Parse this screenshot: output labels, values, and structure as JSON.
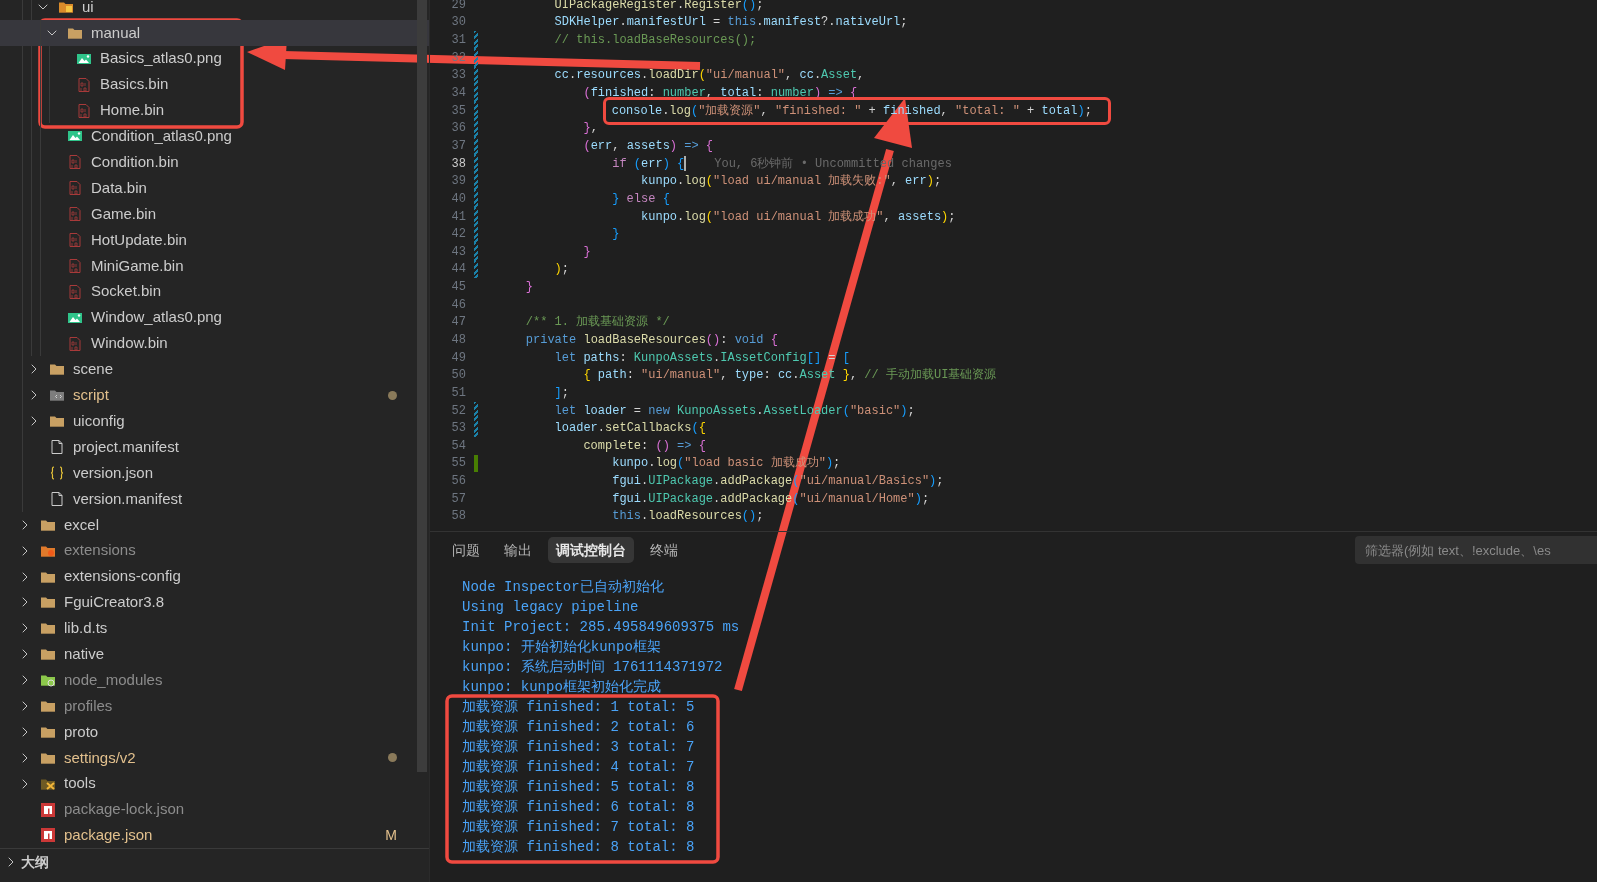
{
  "explorer": {
    "tree": [
      {
        "children": [
          {
            "children": [
              {
                "label": "ui",
                "kind": "folder-ui",
                "expanded": true,
                "selected": false,
                "children": [
                  {
                    "label": "manual",
                    "kind": "folder",
                    "expanded": true,
                    "selected": true,
                    "children": [
                      {
                        "label": "Basics_atlas0.png",
                        "kind": "image",
                        "selected": false
                      },
                      {
                        "label": "Basics.bin",
                        "kind": "binary",
                        "selected": false
                      },
                      {
                        "label": "Home.bin",
                        "kind": "binary",
                        "selected": false
                      }
                    ]
                  },
                  {
                    "label": "Condition_atlas0.png",
                    "kind": "image",
                    "selected": false
                  },
                  {
                    "label": "Condition.bin",
                    "kind": "binary",
                    "selected": false
                  },
                  {
                    "label": "Data.bin",
                    "kind": "binary",
                    "selected": false
                  },
                  {
                    "label": "Game.bin",
                    "kind": "binary",
                    "selected": false
                  },
                  {
                    "label": "HotUpdate.bin",
                    "kind": "binary",
                    "selected": false
                  },
                  {
                    "label": "MiniGame.bin",
                    "kind": "binary",
                    "selected": false
                  },
                  {
                    "label": "Socket.bin",
                    "kind": "binary",
                    "selected": false
                  },
                  {
                    "label": "Window_atlas0.png",
                    "kind": "image",
                    "selected": false
                  },
                  {
                    "label": "Window.bin",
                    "kind": "binary",
                    "selected": false
                  }
                ]
              }
            ]
          },
          {
            "label": "scene",
            "kind": "folder",
            "expanded": false,
            "selected": false
          },
          {
            "label": "script",
            "kind": "folder-script",
            "expanded": false,
            "selected": false,
            "modified": true
          },
          {
            "label": "uiconfig",
            "kind": "folder",
            "expanded": false,
            "selected": false
          },
          {
            "label": "project.manifest",
            "kind": "document",
            "selected": false
          },
          {
            "label": "version.json",
            "kind": "json",
            "selected": false
          },
          {
            "label": "version.manifest",
            "kind": "document",
            "selected": false
          }
        ]
      },
      {
        "label": "excel",
        "kind": "folder",
        "expanded": false,
        "selected": false
      },
      {
        "label": "extensions",
        "kind": "folder-plugin",
        "expanded": false,
        "selected": false,
        "ignored": true
      },
      {
        "label": "extensions-config",
        "kind": "folder",
        "expanded": false,
        "selected": false
      },
      {
        "label": "FguiCreator3.8",
        "kind": "folder",
        "expanded": false,
        "selected": false
      },
      {
        "label": "lib.d.ts",
        "kind": "folder",
        "expanded": false,
        "selected": false
      },
      {
        "label": "native",
        "kind": "folder",
        "expanded": false,
        "selected": false
      },
      {
        "label": "node_modules",
        "kind": "folder-node",
        "expanded": false,
        "selected": false,
        "ignored": true
      },
      {
        "label": "profiles",
        "kind": "folder",
        "expanded": false,
        "selected": false,
        "ignored": true
      },
      {
        "label": "proto",
        "kind": "folder",
        "expanded": false,
        "selected": false
      },
      {
        "label": "settings/v2",
        "kind": "folder",
        "expanded": false,
        "selected": false,
        "modified": true
      },
      {
        "label": "tools",
        "kind": "folder-tools",
        "expanded": false,
        "selected": false
      },
      {
        "label": "package-lock.json",
        "kind": "npm",
        "selected": false,
        "ignored": true
      },
      {
        "label": "package.json",
        "kind": "npm",
        "selected": false,
        "modified": true,
        "badge": "M"
      }
    ],
    "outline": {
      "label": "大纲",
      "expanded": false
    }
  },
  "editor": {
    "lines": [
      {
        "number": "29",
        "active": false,
        "tokens": [
          {
            "kind": "fn",
            "text": "        UIPackageRegister"
          },
          {
            "kind": "punct",
            "text": "."
          },
          {
            "kind": "fn",
            "text": "Register"
          },
          {
            "kind": "b3",
            "text": "()"
          },
          {
            "kind": "punct",
            "text": ";"
          }
        ]
      },
      {
        "number": "30",
        "active": false,
        "tokens": [
          {
            "kind": "var",
            "text": "        SDKHelper"
          },
          {
            "kind": "punct",
            "text": "."
          },
          {
            "kind": "var",
            "text": "manifestUrl"
          },
          {
            "kind": "punct",
            "text": " = "
          },
          {
            "kind": "kw",
            "text": "this"
          },
          {
            "kind": "punct",
            "text": "."
          },
          {
            "kind": "var",
            "text": "manifest"
          },
          {
            "kind": "punct",
            "text": "?."
          },
          {
            "kind": "var",
            "text": "nativeUrl"
          },
          {
            "kind": "punct",
            "text": ";"
          }
        ]
      },
      {
        "number": "31",
        "modified": true,
        "active": false,
        "tokens": [
          {
            "kind": "comment",
            "text": "        // this.loadBaseResources();"
          }
        ]
      },
      {
        "number": "32",
        "modified": true,
        "active": false
      },
      {
        "number": "33",
        "modified": true,
        "active": false,
        "tokens": [
          {
            "kind": "var",
            "text": "        cc"
          },
          {
            "kind": "punct",
            "text": "."
          },
          {
            "kind": "var",
            "text": "resources"
          },
          {
            "kind": "punct",
            "text": "."
          },
          {
            "kind": "fn",
            "text": "loadDir"
          },
          {
            "kind": "b1",
            "text": "("
          },
          {
            "kind": "str",
            "text": "\"ui/manual\""
          },
          {
            "kind": "punct",
            "text": ", "
          },
          {
            "kind": "var",
            "text": "cc"
          },
          {
            "kind": "punct",
            "text": "."
          },
          {
            "kind": "type",
            "text": "Asset"
          },
          {
            "kind": "punct",
            "text": ","
          }
        ]
      },
      {
        "number": "34",
        "modified": true,
        "active": false,
        "tokens": [
          {
            "kind": "b2",
            "text": "            ("
          },
          {
            "kind": "var",
            "text": "finished"
          },
          {
            "kind": "punct",
            "text": ": "
          },
          {
            "kind": "type",
            "text": "number"
          },
          {
            "kind": "punct",
            "text": ", "
          },
          {
            "kind": "var",
            "text": "total"
          },
          {
            "kind": "punct",
            "text": ": "
          },
          {
            "kind": "type",
            "text": "number"
          },
          {
            "kind": "b2",
            "text": ")"
          },
          {
            "kind": "kw",
            "text": " =>"
          },
          {
            "kind": "b2",
            "text": " {"
          }
        ]
      },
      {
        "number": "35",
        "modified": true,
        "highlighted": true,
        "active": false,
        "tokens": [
          {
            "kind": "var",
            "text": "                console"
          },
          {
            "kind": "punct",
            "text": "."
          },
          {
            "kind": "fn",
            "text": "log"
          },
          {
            "kind": "b3",
            "text": "("
          },
          {
            "kind": "str",
            "text": "\"加载资源\""
          },
          {
            "kind": "punct",
            "text": ", "
          },
          {
            "kind": "str",
            "text": "\"finished: \""
          },
          {
            "kind": "punct",
            "text": " + "
          },
          {
            "kind": "var",
            "text": "finished"
          },
          {
            "kind": "punct",
            "text": ", "
          },
          {
            "kind": "str",
            "text": "\"total: \""
          },
          {
            "kind": "punct",
            "text": " + "
          },
          {
            "kind": "var",
            "text": "total"
          },
          {
            "kind": "b3",
            "text": ")"
          },
          {
            "kind": "punct",
            "text": ";"
          }
        ]
      },
      {
        "number": "36",
        "modified": true,
        "active": false,
        "tokens": [
          {
            "kind": "b2",
            "text": "            }"
          },
          {
            "kind": "punct",
            "text": ","
          }
        ]
      },
      {
        "number": "37",
        "modified": true,
        "active": false,
        "tokens": [
          {
            "kind": "b2",
            "text": "            ("
          },
          {
            "kind": "var",
            "text": "err"
          },
          {
            "kind": "punct",
            "text": ", "
          },
          {
            "kind": "var",
            "text": "assets"
          },
          {
            "kind": "b2",
            "text": ")"
          },
          {
            "kind": "kw",
            "text": " =>"
          },
          {
            "kind": "b2",
            "text": " {"
          }
        ]
      },
      {
        "number": "38",
        "modified": true,
        "active": true,
        "blame": "You, 6秒钟前 • Uncommitted changes",
        "tokens": [
          {
            "kind": "ctrl",
            "text": "                if"
          },
          {
            "kind": "b3",
            "text": " ("
          },
          {
            "kind": "var",
            "text": "err"
          },
          {
            "kind": "b3",
            "text": ")"
          },
          {
            "kind": "b3",
            "text": " {"
          }
        ]
      },
      {
        "number": "39",
        "modified": true,
        "active": false,
        "tokens": [
          {
            "kind": "var",
            "text": "                    kunpo"
          },
          {
            "kind": "punct",
            "text": "."
          },
          {
            "kind": "fn",
            "text": "log"
          },
          {
            "kind": "b1",
            "text": "("
          },
          {
            "kind": "str",
            "text": "\"load ui/manual 加载失败:\""
          },
          {
            "kind": "punct",
            "text": ", "
          },
          {
            "kind": "var",
            "text": "err"
          },
          {
            "kind": "b1",
            "text": ")"
          },
          {
            "kind": "punct",
            "text": ";"
          }
        ]
      },
      {
        "number": "40",
        "modified": true,
        "active": false,
        "tokens": [
          {
            "kind": "b3",
            "text": "                }"
          },
          {
            "kind": "ctrl",
            "text": " else"
          },
          {
            "kind": "b3",
            "text": " {"
          }
        ]
      },
      {
        "number": "41",
        "modified": true,
        "active": false,
        "tokens": [
          {
            "kind": "var",
            "text": "                    kunpo"
          },
          {
            "kind": "punct",
            "text": "."
          },
          {
            "kind": "fn",
            "text": "log"
          },
          {
            "kind": "b1",
            "text": "("
          },
          {
            "kind": "str",
            "text": "\"load ui/manual 加载成功\""
          },
          {
            "kind": "punct",
            "text": ", "
          },
          {
            "kind": "var",
            "text": "assets"
          },
          {
            "kind": "b1",
            "text": ")"
          },
          {
            "kind": "punct",
            "text": ";"
          }
        ]
      },
      {
        "number": "42",
        "modified": true,
        "active": false,
        "tokens": [
          {
            "kind": "b3",
            "text": "                }"
          }
        ]
      },
      {
        "number": "43",
        "modified": true,
        "active": false,
        "tokens": [
          {
            "kind": "b2",
            "text": "            }"
          }
        ]
      },
      {
        "number": "44",
        "modified": true,
        "active": false,
        "tokens": [
          {
            "kind": "b1",
            "text": "        )"
          },
          {
            "kind": "punct",
            "text": ";"
          }
        ]
      },
      {
        "number": "45",
        "active": false,
        "tokens": [
          {
            "kind": "b2",
            "text": "    }"
          }
        ]
      },
      {
        "number": "46",
        "active": false
      },
      {
        "number": "47",
        "active": false,
        "tokens": [
          {
            "kind": "comment",
            "text": "    /** 1. 加载基础资源 */"
          }
        ]
      },
      {
        "number": "48",
        "active": false,
        "tokens": [
          {
            "kind": "kw",
            "text": "    private"
          },
          {
            "kind": "fn",
            "text": " loadBaseResources"
          },
          {
            "kind": "b2",
            "text": "()"
          },
          {
            "kind": "punct",
            "text": ": "
          },
          {
            "kind": "kw",
            "text": "void"
          },
          {
            "kind": "b2",
            "text": " {"
          }
        ]
      },
      {
        "number": "49",
        "active": false,
        "tokens": [
          {
            "kind": "kw",
            "text": "        let"
          },
          {
            "kind": "var",
            "text": " paths"
          },
          {
            "kind": "punct",
            "text": ": "
          },
          {
            "kind": "type",
            "text": "KunpoAssets"
          },
          {
            "kind": "punct",
            "text": "."
          },
          {
            "kind": "type",
            "text": "IAssetConfig"
          },
          {
            "kind": "b3",
            "text": "[]"
          },
          {
            "kind": "punct",
            "text": " = "
          },
          {
            "kind": "b3",
            "text": "["
          }
        ]
      },
      {
        "number": "50",
        "active": false,
        "tokens": [
          {
            "kind": "b1",
            "text": "            {"
          },
          {
            "kind": "var",
            "text": " path"
          },
          {
            "kind": "punct",
            "text": ": "
          },
          {
            "kind": "str",
            "text": "\"ui/manual\""
          },
          {
            "kind": "punct",
            "text": ", "
          },
          {
            "kind": "var",
            "text": "type"
          },
          {
            "kind": "punct",
            "text": ": "
          },
          {
            "kind": "var",
            "text": "cc"
          },
          {
            "kind": "punct",
            "text": "."
          },
          {
            "kind": "type",
            "text": "Asset"
          },
          {
            "kind": "b1",
            "text": " }"
          },
          {
            "kind": "punct",
            "text": ", "
          },
          {
            "kind": "comment",
            "text": "// 手动加载UI基础资源"
          }
        ]
      },
      {
        "number": "51",
        "active": false,
        "tokens": [
          {
            "kind": "b3",
            "text": "        ]"
          },
          {
            "kind": "punct",
            "text": ";"
          }
        ]
      },
      {
        "number": "52",
        "modified": true,
        "active": false,
        "tokens": [
          {
            "kind": "kw",
            "text": "        let"
          },
          {
            "kind": "var",
            "text": " loader"
          },
          {
            "kind": "punct",
            "text": " = "
          },
          {
            "kind": "kw",
            "text": "new"
          },
          {
            "kind": "type",
            "text": " KunpoAssets"
          },
          {
            "kind": "punct",
            "text": "."
          },
          {
            "kind": "type",
            "text": "AssetLoader"
          },
          {
            "kind": "b3",
            "text": "("
          },
          {
            "kind": "str",
            "text": "\"basic\""
          },
          {
            "kind": "b3",
            "text": ")"
          },
          {
            "kind": "punct",
            "text": ";"
          }
        ]
      },
      {
        "number": "53",
        "modified": true,
        "active": false,
        "tokens": [
          {
            "kind": "var",
            "text": "        loader"
          },
          {
            "kind": "punct",
            "text": "."
          },
          {
            "kind": "fn",
            "text": "setCallbacks"
          },
          {
            "kind": "b3",
            "text": "("
          },
          {
            "kind": "b1",
            "text": "{"
          }
        ]
      },
      {
        "number": "54",
        "active": false,
        "tokens": [
          {
            "kind": "fn",
            "text": "            complete"
          },
          {
            "kind": "punct",
            "text": ": "
          },
          {
            "kind": "b2",
            "text": "()"
          },
          {
            "kind": "kw",
            "text": " =>"
          },
          {
            "kind": "b2",
            "text": " {"
          }
        ]
      },
      {
        "number": "55",
        "added": true,
        "active": false,
        "tokens": [
          {
            "kind": "var",
            "text": "                kunpo"
          },
          {
            "kind": "punct",
            "text": "."
          },
          {
            "kind": "fn",
            "text": "log"
          },
          {
            "kind": "b3",
            "text": "("
          },
          {
            "kind": "str",
            "text": "\"load basic 加载成功\""
          },
          {
            "kind": "b3",
            "text": ")"
          },
          {
            "kind": "punct",
            "text": ";"
          }
        ]
      },
      {
        "number": "56",
        "active": false,
        "tokens": [
          {
            "kind": "var",
            "text": "                fgui"
          },
          {
            "kind": "punct",
            "text": "."
          },
          {
            "kind": "type",
            "text": "UIPackage"
          },
          {
            "kind": "punct",
            "text": "."
          },
          {
            "kind": "fn",
            "text": "addPackage"
          },
          {
            "kind": "b3",
            "text": "("
          },
          {
            "kind": "str",
            "text": "\"ui/manual/Basics\""
          },
          {
            "kind": "b3",
            "text": ")"
          },
          {
            "kind": "punct",
            "text": ";"
          }
        ]
      },
      {
        "number": "57",
        "active": false,
        "tokens": [
          {
            "kind": "var",
            "text": "                fgui"
          },
          {
            "kind": "punct",
            "text": "."
          },
          {
            "kind": "type",
            "text": "UIPackage"
          },
          {
            "kind": "punct",
            "text": "."
          },
          {
            "kind": "fn",
            "text": "addPackage"
          },
          {
            "kind": "b3",
            "text": "("
          },
          {
            "kind": "str",
            "text": "\"ui/manual/Home\""
          },
          {
            "kind": "b3",
            "text": ")"
          },
          {
            "kind": "punct",
            "text": ";"
          }
        ]
      },
      {
        "number": "58",
        "active": false,
        "tokens": [
          {
            "kind": "kw",
            "text": "                this"
          },
          {
            "kind": "punct",
            "text": "."
          },
          {
            "kind": "fn",
            "text": "loadResources"
          },
          {
            "kind": "b3",
            "text": "()"
          },
          {
            "kind": "punct",
            "text": ";"
          }
        ]
      }
    ]
  },
  "panel": {
    "tabs": [
      {
        "label": "问题",
        "selected": false
      },
      {
        "label": "输出",
        "selected": false
      },
      {
        "label": "调试控制台",
        "selected": true
      },
      {
        "label": "终端",
        "selected": false
      }
    ],
    "filter": {
      "placeholder": "筛选器(例如 text、!exclude、\\es"
    },
    "console": [
      "Node Inspector已自动初始化",
      "Using legacy pipeline",
      "Init Project: 285.495849609375 ms",
      "kunpo: 开始初始化kunpo框架",
      "kunpo: 系统启动时间 1761114371972",
      "kunpo: kunpo框架初始化完成",
      "加载资源 finished: 1 total: 5",
      "加载资源 finished: 2 total: 6",
      "加载资源 finished: 3 total: 7",
      "加载资源 finished: 4 total: 7",
      "加载资源 finished: 5 total: 8",
      "加载资源 finished: 6 total: 8",
      "加载资源 finished: 7 total: 8",
      "加载资源 finished: 8 total: 8"
    ]
  }
}
